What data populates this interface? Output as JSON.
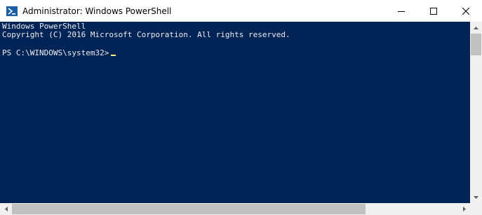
{
  "window": {
    "title": "Administrator: Windows PowerShell",
    "icon": "powershell-icon"
  },
  "caption_buttons": {
    "minimize_icon": "minimize-icon",
    "maximize_icon": "maximize-icon",
    "close_icon": "close-icon"
  },
  "console": {
    "lines": [
      "Windows PowerShell",
      "Copyright (C) 2016 Microsoft Corporation. All rights reserved."
    ],
    "prompt": "PS C:\\WINDOWS\\system32>"
  },
  "colors": {
    "console_background": "#012456",
    "console_text": "#eeedf0",
    "cursor": "#fef07a"
  },
  "scrollbars": {
    "up_icon": "scroll-up-icon",
    "down_icon": "scroll-down-icon",
    "left_icon": "scroll-left-icon",
    "right_icon": "scroll-right-icon"
  }
}
